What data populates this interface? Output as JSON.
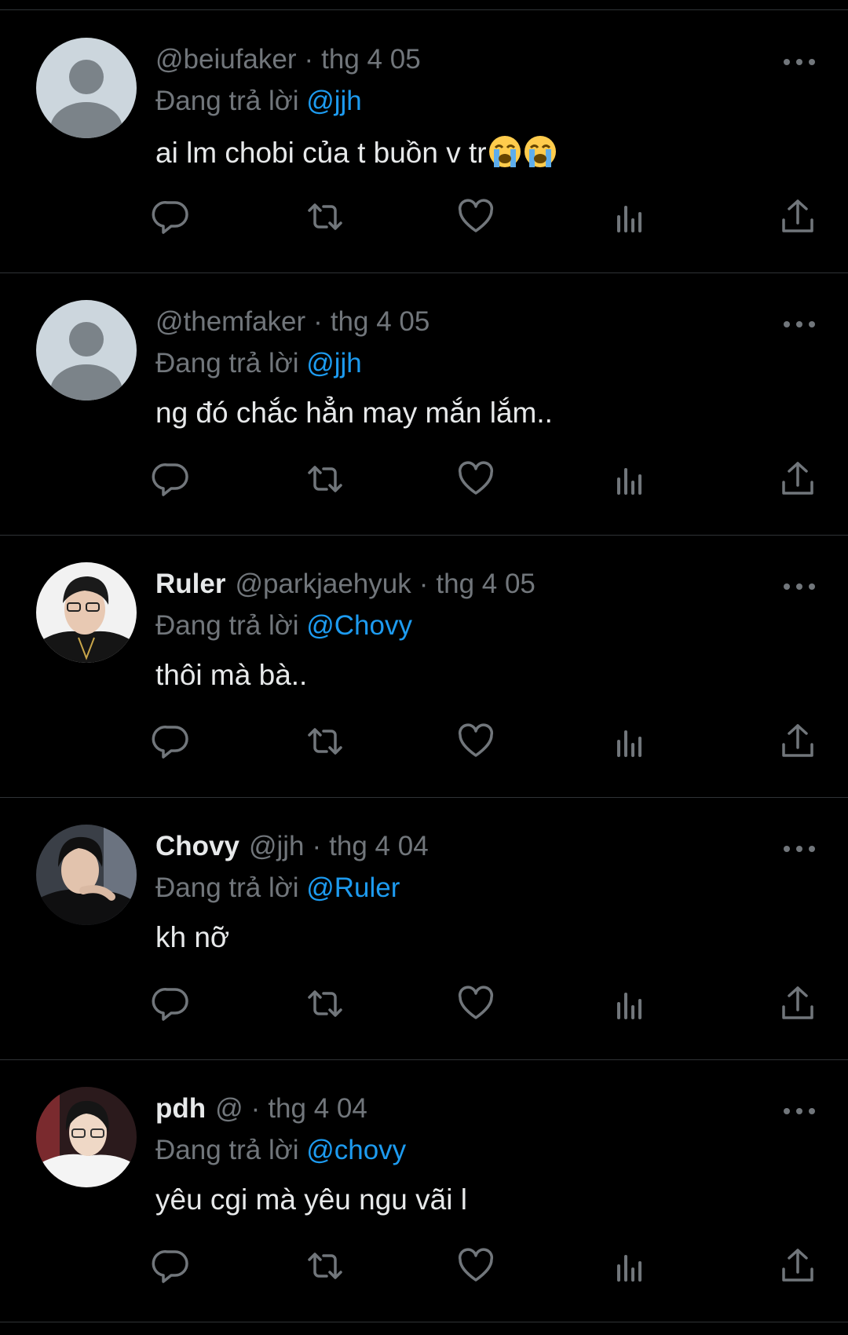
{
  "theme": {
    "bg": "#000000",
    "text": "#e7e9ea",
    "muted": "#71767b",
    "accent": "#1d9bf0",
    "divider": "#2f3336"
  },
  "tweets": [
    {
      "name": "",
      "handle": "@beiufaker",
      "dot": "·",
      "time": "thg 4 05",
      "replying_prefix": "Đang trả lời",
      "replying_to": "@jjh",
      "text": "ai lm chobi của t buồn v tr",
      "emojis": [
        "loudly-crying-face",
        "loudly-crying-face"
      ],
      "avatar": "default-avatar"
    },
    {
      "name": "",
      "handle": "@themfaker",
      "dot": "·",
      "time": "thg 4 05",
      "replying_prefix": "Đang trả lời",
      "replying_to": "@jjh",
      "text": "ng đó chắc hẳn may mắn lắm..",
      "avatar": "default-avatar"
    },
    {
      "name": "Ruler",
      "handle": "@parkjaehyuk",
      "dot": "·",
      "time": "thg 4 05",
      "replying_prefix": "Đang trả lời",
      "replying_to": "@Chovy",
      "text": "thôi mà bà..",
      "avatar": "photo"
    },
    {
      "name": "Chovy",
      "handle": "@jjh",
      "dot": "·",
      "time": "thg 4 04",
      "replying_prefix": "Đang trả lời",
      "replying_to": "@Ruler",
      "text": "kh nỡ",
      "avatar": "photo"
    },
    {
      "name": "pdh",
      "handle": "@",
      "dot": "·",
      "time": "thg 4 04",
      "replying_prefix": "Đang trả lời",
      "replying_to": "@chovy",
      "text": "yêu cgi mà yêu ngu vãi l",
      "avatar": "photo"
    }
  ],
  "action_icons": [
    "reply-icon",
    "retweet-icon",
    "like-icon",
    "views-icon",
    "share-icon"
  ]
}
